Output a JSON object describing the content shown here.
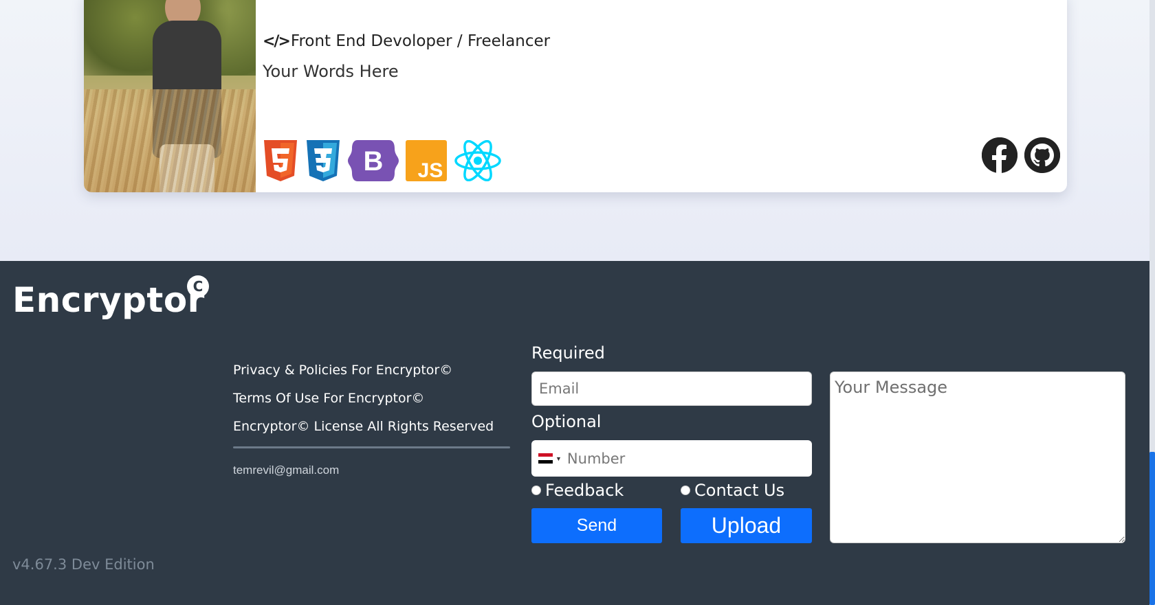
{
  "profile": {
    "role": "Front End Devoloper / Freelancer",
    "words": "Your Words Here",
    "tech_icons": [
      "html5-icon",
      "css3-icon",
      "bootstrap-icon",
      "javascript-icon",
      "react-icon"
    ],
    "social_icons": [
      "facebook-icon",
      "github-icon"
    ]
  },
  "footer": {
    "brand": "Encryptor",
    "brand_mark": "C",
    "links": [
      "Privacy & Policies For Encryptor©",
      "Terms Of Use For Encryptor©",
      "Encryptor© License All Rights Reserved"
    ],
    "email": "temrevil@gmail.com",
    "version": "v4.67.3 Dev Edition"
  },
  "form": {
    "required_label": "Required",
    "email_placeholder": "Email",
    "optional_label": "Optional",
    "number_placeholder": "Number",
    "radio_feedback": "Feedback",
    "radio_contact": "Contact Us",
    "send_label": "Send",
    "upload_label": "Upload",
    "message_placeholder": "Your Message"
  },
  "colors": {
    "footer_bg": "#2f3a46",
    "button_blue": "#0d6efd",
    "page_bg": "#eef1f8"
  }
}
